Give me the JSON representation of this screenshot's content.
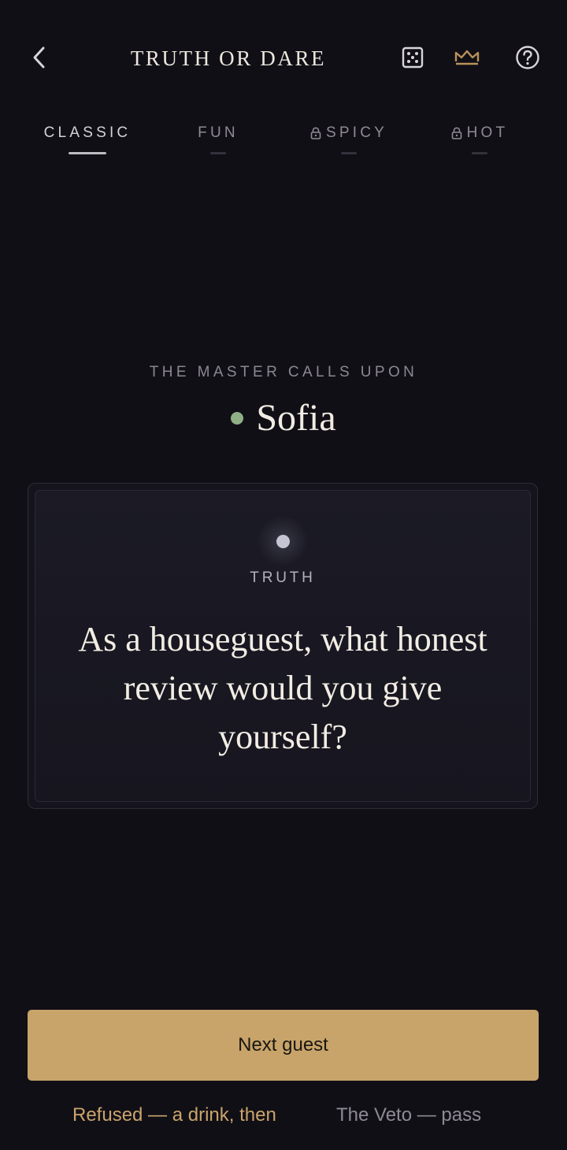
{
  "header": {
    "title": "TRUTH OR DARE",
    "icons": [
      "back-chevron-icon",
      "dice-icon",
      "crown-icon",
      "help-icon"
    ],
    "crown_color": "#b9925a"
  },
  "tabs": [
    {
      "label": "CLASSIC",
      "active": true,
      "locked": false
    },
    {
      "label": "FUN",
      "active": false,
      "locked": false
    },
    {
      "label": "SPICY",
      "active": false,
      "locked": true
    },
    {
      "label": "HOT",
      "active": false,
      "locked": true
    }
  ],
  "called": {
    "caption": "THE MASTER CALLS UPON",
    "player_name": "Sofia",
    "player_dot_color": "#8faf86"
  },
  "card": {
    "type": "TRUTH",
    "question": "As a houseguest, what honest review would you give yourself?"
  },
  "actions": {
    "next_label": "Next guest",
    "refuse_label": "Refused — a drink, then",
    "veto_label": "The Veto — pass"
  },
  "colors": {
    "background": "#110f16",
    "accent_gold": "#c8a46a"
  }
}
